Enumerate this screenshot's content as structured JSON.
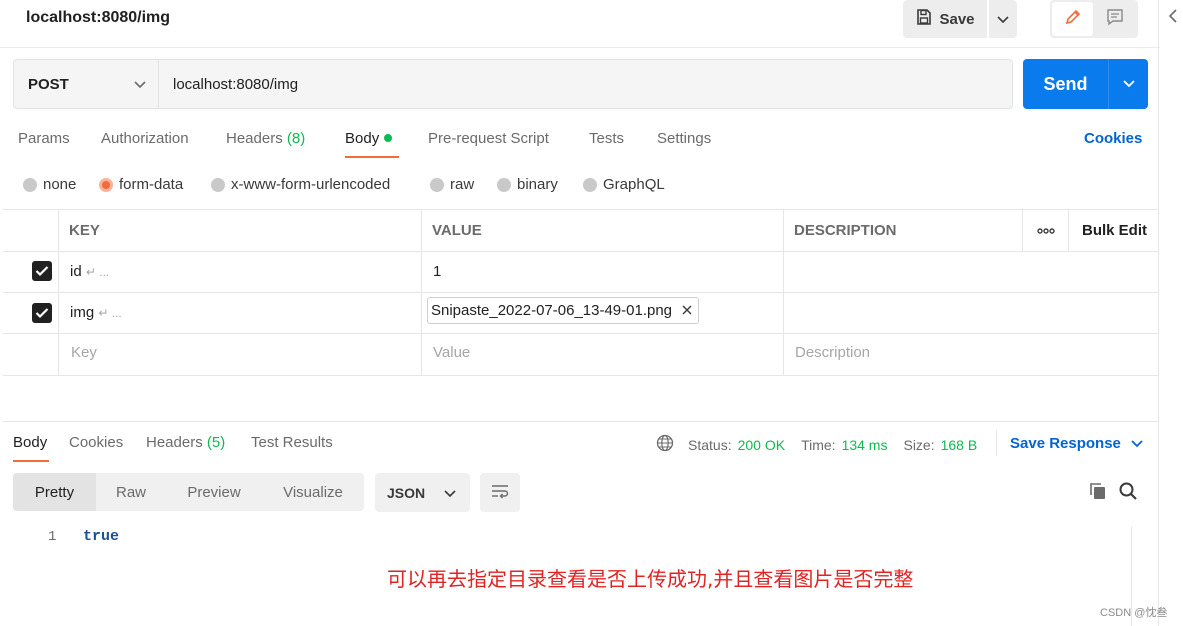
{
  "header": {
    "title": "localhost:8080/img",
    "save_label": "Save"
  },
  "request": {
    "method": "POST",
    "url": "localhost:8080/img",
    "send_label": "Send"
  },
  "request_tabs": {
    "params": "Params",
    "authorization": "Authorization",
    "headers": "Headers",
    "headers_count": "(8)",
    "body": "Body",
    "pre_request": "Pre-request Script",
    "tests": "Tests",
    "settings": "Settings",
    "cookies": "Cookies"
  },
  "body_types": {
    "none": "none",
    "form_data": "form-data",
    "urlencoded": "x-www-form-urlencoded",
    "raw": "raw",
    "binary": "binary",
    "graphql": "GraphQL",
    "selected": "form-data"
  },
  "params_table": {
    "headers": {
      "key": "KEY",
      "value": "VALUE",
      "description": "DESCRIPTION",
      "bulk_edit": "Bulk Edit"
    },
    "rows": [
      {
        "key": "id",
        "value": "1",
        "checked": true
      },
      {
        "key": "img",
        "file": "Snipaste_2022-07-06_13-49-01.png",
        "checked": true
      }
    ],
    "more_hint": "↵ ...",
    "placeholders": {
      "key": "Key",
      "value": "Value",
      "description": "Description"
    }
  },
  "response": {
    "tabs": {
      "body": "Body",
      "cookies": "Cookies",
      "headers": "Headers",
      "headers_count": "(5)",
      "test_results": "Test Results"
    },
    "status_label": "Status:",
    "status_value": "200 OK",
    "time_label": "Time:",
    "time_value": "134 ms",
    "size_label": "Size:",
    "size_value": "168 B",
    "save_response": "Save Response",
    "view_tabs": {
      "pretty": "Pretty",
      "raw": "Raw",
      "preview": "Preview",
      "visualize": "Visualize"
    },
    "format": "JSON",
    "line_number": "1",
    "body_value": "true"
  },
  "annotation": "可以再去指定目录查看是否上传成功,并且查看图片是否完整",
  "watermark": "CSDN @忱叁",
  "colors": {
    "accent_orange": "#f26b3a",
    "send_blue": "#097bed",
    "link_blue": "#0265d2",
    "success_green": "#0cbb52",
    "annotation_red": "#e02424"
  }
}
